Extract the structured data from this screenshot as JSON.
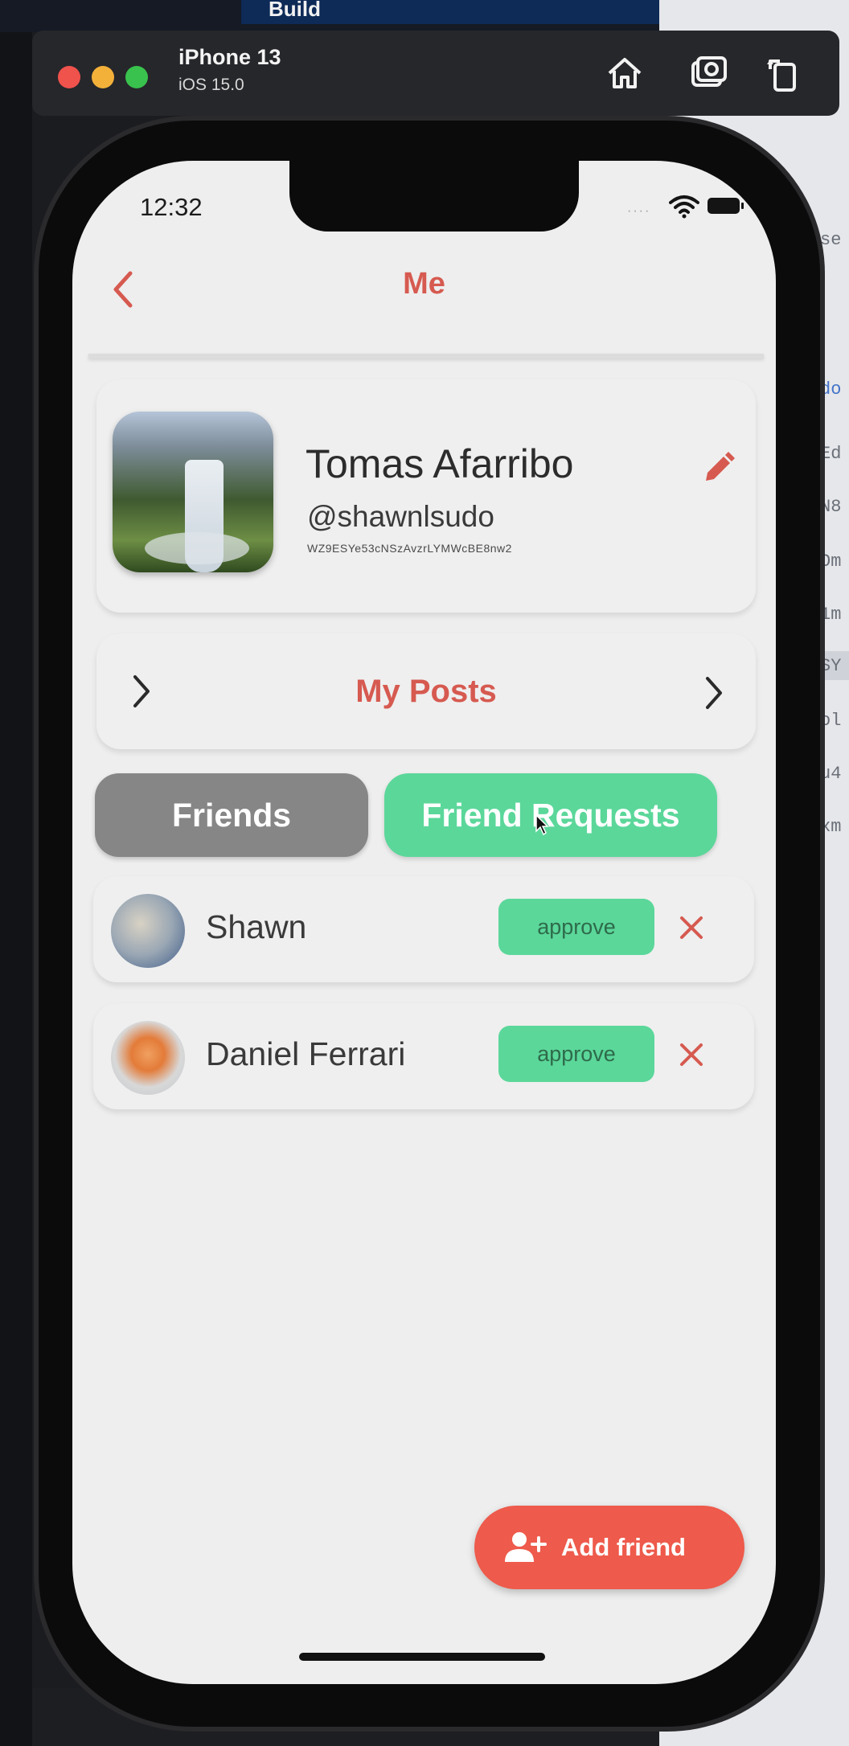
{
  "desktop": {
    "build_label": "Build",
    "right_panel_fragments": [
      "Ed",
      "N8",
      "Om",
      "1m",
      "SY",
      "ol",
      "u4",
      "xm",
      "se",
      "do"
    ]
  },
  "simulator": {
    "device_name": "iPhone 13",
    "os_version": "iOS 15.0",
    "icons": [
      "home-icon",
      "screenshot-icon",
      "rotate-icon"
    ]
  },
  "status_bar": {
    "time": "12:32",
    "signal": "····"
  },
  "nav": {
    "title": "Me",
    "back_icon": "chevron-left-icon"
  },
  "profile": {
    "name": "Tomas Afarribo",
    "handle": "@shawnlsudo",
    "user_id": "WZ9ESYe53cNSzAvzrLYMWcBE8nw2",
    "edit_icon": "pencil-icon"
  },
  "posts": {
    "label": "My Posts"
  },
  "tabs": {
    "friends": "Friends",
    "requests": "Friend Requests",
    "active": "requests"
  },
  "requests": [
    {
      "name": "Shawn",
      "approve_label": "approve"
    },
    {
      "name": "Daniel Ferrari",
      "approve_label": "approve"
    }
  ],
  "fab": {
    "label": "Add friend",
    "icon": "person-add-icon"
  },
  "colors": {
    "accent_red": "#d65a50",
    "fab_red": "#ee5a4b",
    "approve_green": "#5bd79a",
    "inactive_tab": "#868686",
    "screen_bg": "#eeeeee"
  }
}
